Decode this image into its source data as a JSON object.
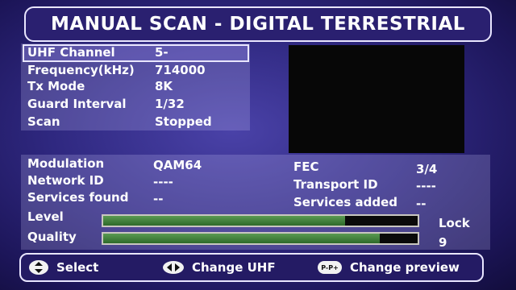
{
  "title": "MANUAL SCAN - DIGITAL TERRESTRIAL",
  "scan_settings": [
    {
      "label": "UHF Channel",
      "value": "5-"
    },
    {
      "label": "Frequency(kHz)",
      "value": "714000"
    },
    {
      "label": "Tx Mode",
      "value": "8K"
    },
    {
      "label": "Guard Interval",
      "value": "1/32"
    },
    {
      "label": "Scan",
      "value": "Stopped"
    }
  ],
  "status": {
    "modulation": {
      "label": "Modulation",
      "value": "QAM64"
    },
    "network_id": {
      "label": "Network ID",
      "value": "----"
    },
    "services_found": {
      "label": "Services found",
      "value": "--"
    },
    "fec": {
      "label": "FEC",
      "value": "3/4"
    },
    "transport_id": {
      "label": "Transport ID",
      "value": "----"
    },
    "services_added": {
      "label": "Services added",
      "value": "--"
    }
  },
  "signal": {
    "level": {
      "label": "Level",
      "fill_fraction": 0.77
    },
    "quality": {
      "label": "Quality",
      "fill_fraction": 0.88
    },
    "lock": {
      "label": "Lock",
      "value": "9"
    }
  },
  "footer": [
    {
      "icon": "up-down-arrow-icon",
      "label": "Select"
    },
    {
      "icon": "left-right-arrow-icon",
      "label": "Change UHF"
    },
    {
      "icon": "p-minus-p-plus-icon",
      "icon_text": "P-P+",
      "label": "Change preview"
    }
  ],
  "colors": {
    "background": "#2f2880",
    "bar_fill": "#4a8a44",
    "preview": "#070707"
  }
}
